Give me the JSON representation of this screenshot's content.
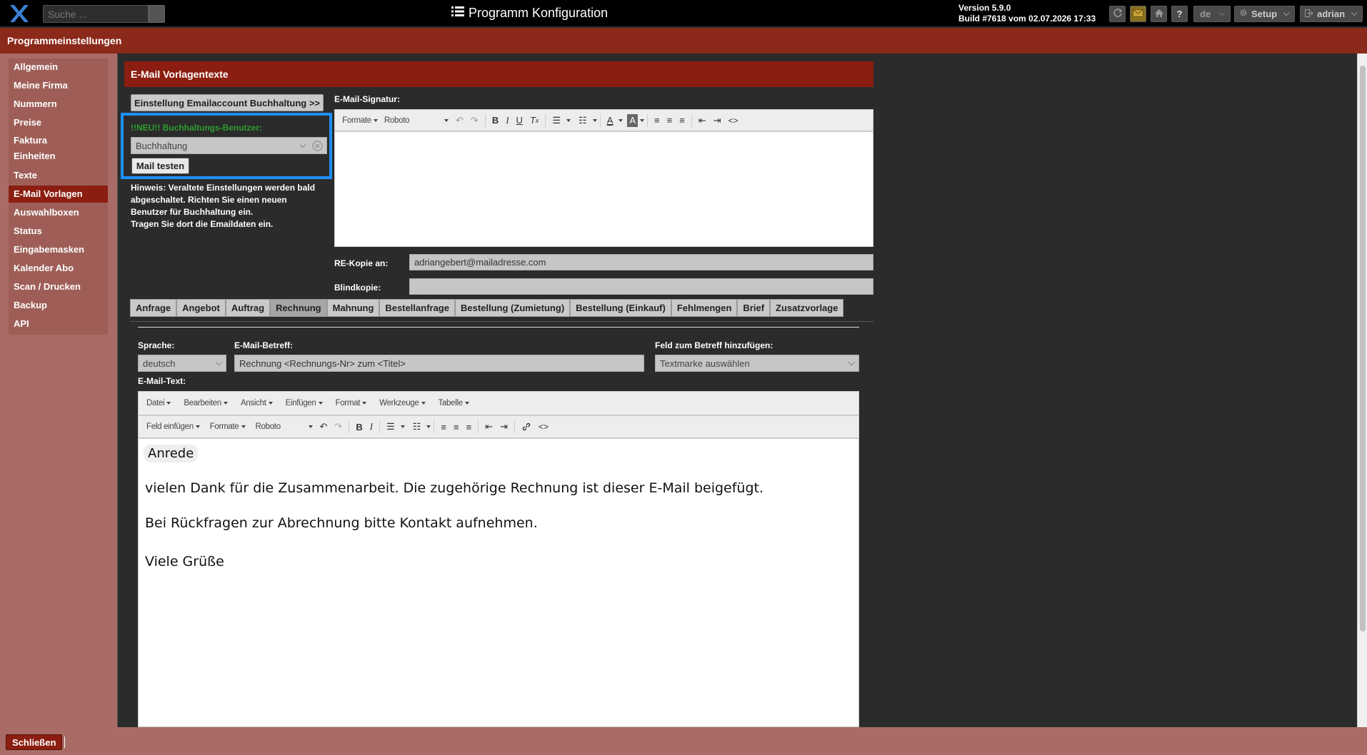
{
  "topbar": {
    "search_placeholder": "Suche ...",
    "title": "Programm Konfiguration",
    "version": "Version 5.9.0",
    "build": "Build #7618 vom 02.07.2026 17:33",
    "language": "de",
    "setup_label": "Setup",
    "user_label": "adrian",
    "help_label": "?"
  },
  "header": {
    "title": "Programmeinstellungen"
  },
  "sidebar": {
    "items": [
      {
        "label": "Allgemein"
      },
      {
        "label": "Meine Firma"
      },
      {
        "label": "Nummern"
      },
      {
        "label": "Preise"
      },
      {
        "label": "Faktura"
      },
      {
        "label": "Einheiten"
      },
      {
        "label": "Texte"
      },
      {
        "label": "E-Mail Vorlagen",
        "active": true
      },
      {
        "label": "Auswahlboxen"
      },
      {
        "label": "Status"
      },
      {
        "label": "Eingabemasken"
      },
      {
        "label": "Kalender Abo"
      },
      {
        "label": "Scan / Drucken"
      },
      {
        "label": "Backup"
      },
      {
        "label": "API"
      }
    ]
  },
  "section": {
    "title": "E-Mail Vorlagentexte",
    "account_button": "Einstellung Emailaccount Buchhaltung >>",
    "neu_label": "!!NEU!! Buchhaltungs-Benutzer:",
    "user_select_value": "Buchhaltung",
    "test_mail_button": "Mail testen",
    "hint_lines": [
      "Hinweis: Veraltete Einstellungen werden bald",
      "abgeschaltet. Richten Sie einen neuen",
      "Benutzer für Buchhaltung ein.",
      "Tragen Sie dort die Emaildaten ein."
    ],
    "signature_label": "E-Mail-Signatur:",
    "signature_toolbar": {
      "formats": "Formate",
      "font": "Roboto"
    },
    "re_copy_label": "RE-Kopie an:",
    "re_copy_value": "adriangebert@mailadresse.com",
    "bcc_label": "Blindkopie:",
    "bcc_value": ""
  },
  "tabs": [
    {
      "label": "Anfrage"
    },
    {
      "label": "Angebot"
    },
    {
      "label": "Auftrag"
    },
    {
      "label": "Rechnung",
      "active": true
    },
    {
      "label": "Mahnung"
    },
    {
      "label": "Bestellanfrage"
    },
    {
      "label": "Bestellung (Zumietung)"
    },
    {
      "label": "Bestellung (Einkauf)"
    },
    {
      "label": "Fehlmengen"
    },
    {
      "label": "Brief"
    },
    {
      "label": "Zusatzvorlage"
    }
  ],
  "template": {
    "language_label": "Sprache:",
    "language_value": "deutsch",
    "subject_label": "E-Mail-Betreff:",
    "subject_value": "Rechnung <Rechnungs-Nr> zum <Titel>",
    "add_field_label": "Feld zum Betreff hinzufügen:",
    "add_field_value": "Textmarke auswählen",
    "text_label": "E-Mail-Text:",
    "menu": [
      "Datei",
      "Bearbeiten",
      "Ansicht",
      "Einfügen",
      "Format",
      "Werkzeuge",
      "Tabelle"
    ],
    "toolbar": {
      "insert_field": "Feld einfügen",
      "formats": "Formate",
      "font": "Roboto"
    },
    "body": {
      "anrede": "Anrede",
      "p1": "vielen Dank für die Zusammenarbeit. Die zugehörige Rechnung ist dieser E-Mail beigefügt.",
      "p2": "Bei Rückfragen zur Abrechnung bitte Kontakt aufnehmen.",
      "p3": "Viele Grüße"
    }
  },
  "footer": {
    "close_label": "Schließen"
  },
  "colors": {
    "accent_red": "#8b1e10",
    "highlight_blue": "#1e90ff",
    "neu_green": "#2e9e2e"
  }
}
